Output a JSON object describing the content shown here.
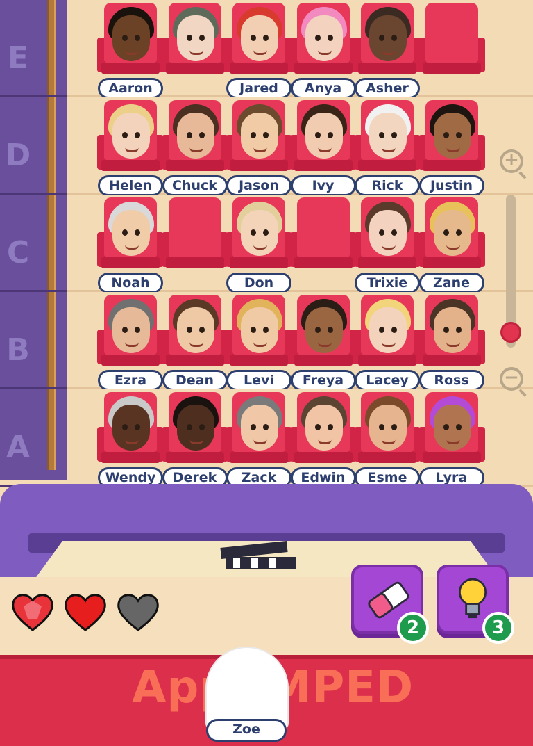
{
  "rows": [
    {
      "letter": "E",
      "seats": [
        {
          "name": "Aaron",
          "occupied": true,
          "hair": "#1a120c",
          "skin": "#6b4226"
        },
        {
          "name": "",
          "occupied": true,
          "hair": "#5e6b5a",
          "skin": "#f1d6c4"
        },
        {
          "name": "Jared",
          "occupied": true,
          "hair": "#d83a2e",
          "skin": "#f2cfb3"
        },
        {
          "name": "Anya",
          "occupied": true,
          "hair": "#f28ac0",
          "skin": "#f3d2bf"
        },
        {
          "name": "Asher",
          "occupied": true,
          "hair": "#3b2a22",
          "skin": "#6a4530"
        },
        {
          "name": "",
          "occupied": false,
          "hair": "",
          "skin": ""
        }
      ]
    },
    {
      "letter": "D",
      "seats": [
        {
          "name": "Helen",
          "occupied": true,
          "hair": "#ecd08a",
          "skin": "#f3d3bc"
        },
        {
          "name": "Chuck",
          "occupied": true,
          "hair": "#4a3020",
          "skin": "#e7b998"
        },
        {
          "name": "Jason",
          "occupied": true,
          "hair": "#6b4a2e",
          "skin": "#f1caa6"
        },
        {
          "name": "Ivy",
          "occupied": true,
          "hair": "#3a2418",
          "skin": "#f2ccb0"
        },
        {
          "name": "Rick",
          "occupied": true,
          "hair": "#f1f1f1",
          "skin": "#f3d6bf"
        },
        {
          "name": "Justin",
          "occupied": true,
          "hair": "#1e1510",
          "skin": "#a06a45"
        }
      ]
    },
    {
      "letter": "C",
      "seats": [
        {
          "name": "Noah",
          "occupied": true,
          "hair": "#d9d9d9",
          "skin": "#f0cca9"
        },
        {
          "name": "",
          "occupied": false,
          "hair": "",
          "skin": ""
        },
        {
          "name": "Don",
          "occupied": true,
          "hair": "#e2cf9c",
          "skin": "#f3d4b8"
        },
        {
          "name": "",
          "occupied": false,
          "hair": "",
          "skin": ""
        },
        {
          "name": "Trixie",
          "occupied": true,
          "hair": "#5a3a2a",
          "skin": "#f3d3bf"
        },
        {
          "name": "Zane",
          "occupied": true,
          "hair": "#e8c15a",
          "skin": "#e6b98d"
        }
      ]
    },
    {
      "letter": "B",
      "seats": [
        {
          "name": "Ezra",
          "occupied": true,
          "hair": "#707070",
          "skin": "#e6b998"
        },
        {
          "name": "Dean",
          "occupied": true,
          "hair": "#5a3a26",
          "skin": "#efc9a5"
        },
        {
          "name": "Levi",
          "occupied": true,
          "hair": "#e1b45c",
          "skin": "#f0c9a5"
        },
        {
          "name": "Freya",
          "occupied": true,
          "hair": "#2a1d15",
          "skin": "#9a6642"
        },
        {
          "name": "Lacey",
          "occupied": true,
          "hair": "#f2d47a",
          "skin": "#f3d3bc"
        },
        {
          "name": "Ross",
          "occupied": true,
          "hair": "#4a3426",
          "skin": "#e4b28a"
        }
      ]
    },
    {
      "letter": "A",
      "seats": [
        {
          "name": "Wendy",
          "occupied": true,
          "hair": "#c9c9c9",
          "skin": "#5a3422"
        },
        {
          "name": "Derek",
          "occupied": true,
          "hair": "#1a120e",
          "skin": "#4e2f1f"
        },
        {
          "name": "Zack",
          "occupied": true,
          "hair": "#7a7a7a",
          "skin": "#f0c8a8"
        },
        {
          "name": "Edwin",
          "occupied": true,
          "hair": "#5b4432",
          "skin": "#f0c4a4"
        },
        {
          "name": "Esme",
          "occupied": true,
          "hair": "#7a4a2a",
          "skin": "#e6b48e"
        },
        {
          "name": "Lyra",
          "occupied": true,
          "hair": "#b44bd6",
          "skin": "#b07450"
        }
      ]
    }
  ],
  "zoom": {
    "in_icon": "zoom-in-icon",
    "out_icon": "zoom-out-icon",
    "in_symbol": "+",
    "out_symbol": "−",
    "level": 0.1
  },
  "lives": [
    {
      "state": "full",
      "color": "#e8333a"
    },
    {
      "state": "full",
      "color": "#e8333a"
    },
    {
      "state": "empty",
      "color": "#666666"
    }
  ],
  "powerups": [
    {
      "icon": "eraser-icon",
      "count": "2"
    },
    {
      "icon": "lightbulb-icon",
      "count": "3"
    }
  ],
  "current_guest": {
    "name": "Zoe"
  },
  "watermark": "AppAMPED"
}
